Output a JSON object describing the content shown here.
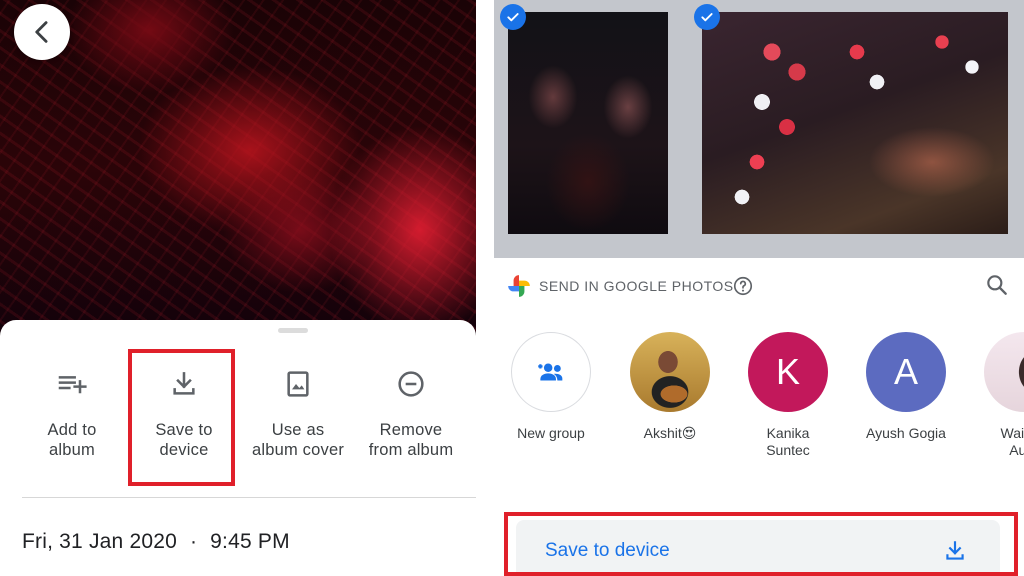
{
  "left_panel": {
    "actions": [
      {
        "label": "Add to\nalbum",
        "icon": "playlist-add-icon"
      },
      {
        "label": "Save to\ndevice",
        "icon": "download-icon"
      },
      {
        "label": "Use as\nalbum cover",
        "icon": "image-frame-icon"
      },
      {
        "label": "Remove\nfrom album",
        "icon": "remove-circle-icon"
      }
    ],
    "date": "Fri, 31 Jan 2020",
    "separator": "·",
    "time": "9:45 PM"
  },
  "right_panel": {
    "send_header": "SEND IN GOOGLE PHOTOS",
    "contacts": [
      {
        "name": "New group",
        "initial": ""
      },
      {
        "name": "Akshit😍",
        "initial": ""
      },
      {
        "name": "Kanika\nSuntec",
        "initial": "K"
      },
      {
        "name": "Ayush Gogia",
        "initial": "A"
      },
      {
        "name": "Waiddo\nAura",
        "initial": ""
      }
    ],
    "save_to_device": "Save to device"
  },
  "colors": {
    "accent_blue": "#1a73e8",
    "highlight_red": "#e0202a",
    "avatar_kanika": "#c2185b",
    "avatar_ayush": "#5c6bc0"
  }
}
